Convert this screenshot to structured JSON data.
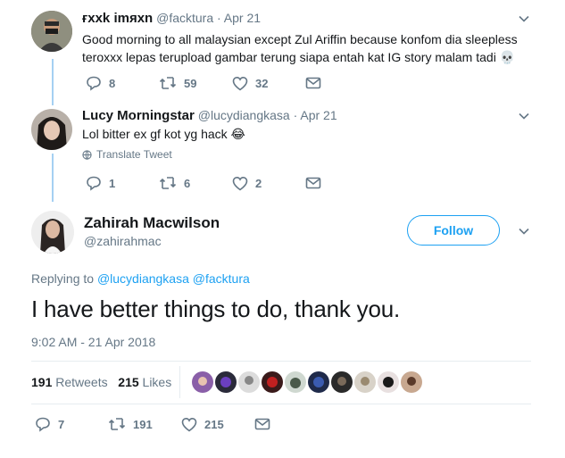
{
  "tweets": [
    {
      "display_name": "ғxxk imяxn",
      "handle": "@facktura",
      "date": "· Apr 21",
      "text_line1": "Good morning to all malaysian except Zul Ariffin because konfom dia sleepless",
      "text_line2": "teroxxx lepas terupload gambar terung siapa entah kat IG story malam tadi 💀",
      "replies": "8",
      "retweets": "59",
      "likes": "32"
    },
    {
      "display_name": "Lucy Morningstar",
      "handle": "@lucydiangkasa",
      "date": "· Apr 21",
      "text": "Lol bitter ex gf kot yg hack 😂",
      "translate": "Translate Tweet",
      "replies": "1",
      "retweets": "6",
      "likes": "2"
    }
  ],
  "main": {
    "display_name": "Zahirah Macwilson",
    "handle": "@zahirahmac",
    "follow_label": "Follow",
    "replying_prefix": "Replying to",
    "replying_to_1": "@lucydiangkasa",
    "replying_to_2": "@facktura",
    "text": "I have better things to do, thank you.",
    "timestamp": "9:02 AM - 21 Apr 2018",
    "retweet_count": "191",
    "retweet_label": "Retweets",
    "like_count": "215",
    "like_label": "Likes",
    "replies": "7",
    "retweets": "191",
    "likes": "215"
  },
  "colors": {
    "accent": "#1da1f2",
    "muted": "#657786",
    "thread_line": "#a5d0f2"
  }
}
